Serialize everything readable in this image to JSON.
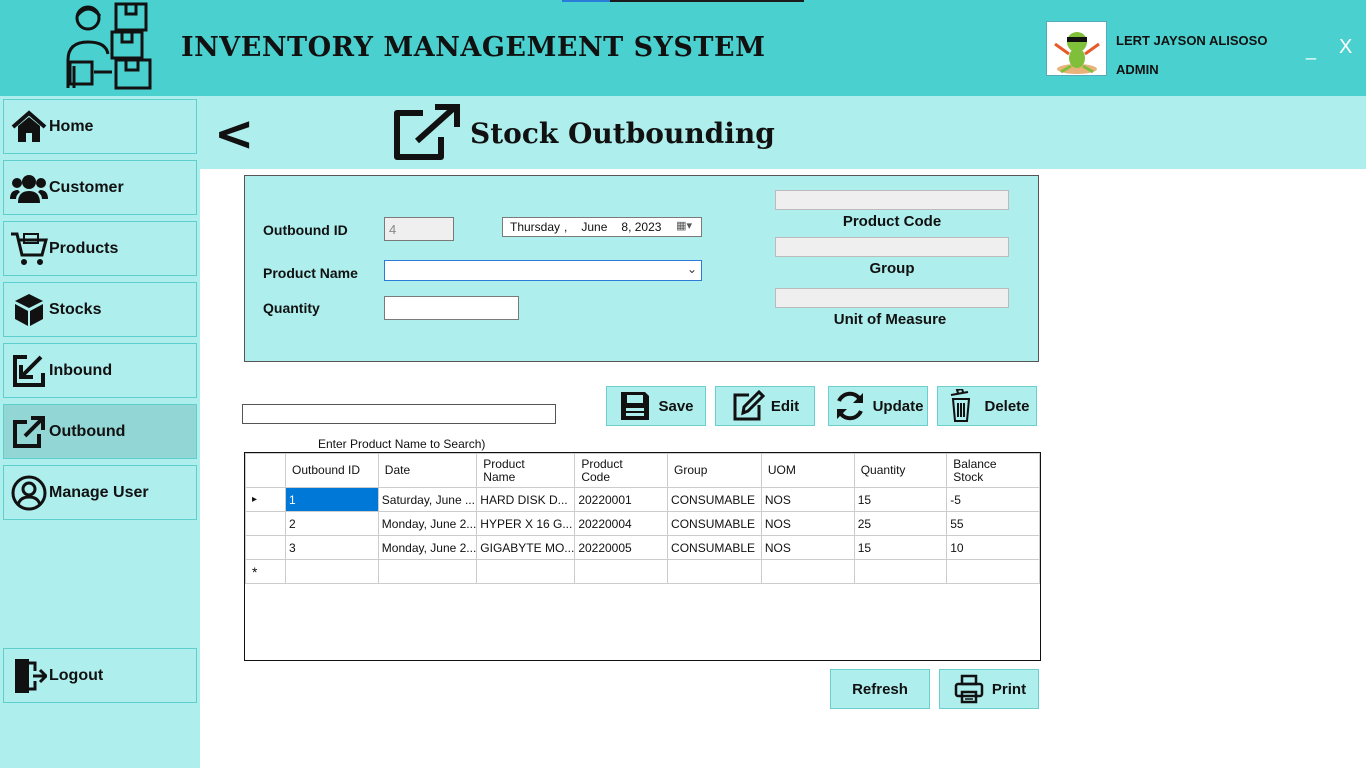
{
  "app": {
    "title": "INVENTORY MANAGEMENT SYSTEM",
    "user_name": "LERT JAYSON ALISOSO",
    "user_role": "ADMIN",
    "minimize_label": "_",
    "close_label": "X"
  },
  "sidebar": {
    "items": [
      {
        "label": "Home",
        "icon": "home-icon"
      },
      {
        "label": "Customer",
        "icon": "customers-icon"
      },
      {
        "label": "Products",
        "icon": "cart-icon"
      },
      {
        "label": "Stocks",
        "icon": "boxes-icon"
      },
      {
        "label": "Inbound",
        "icon": "inbound-icon"
      },
      {
        "label": "Outbound",
        "icon": "outbound-icon",
        "active": true
      },
      {
        "label": "Manage User",
        "icon": "user-icon"
      }
    ],
    "logout_label": "Logout"
  },
  "page": {
    "back_label": "<",
    "title": "Stock Outbounding"
  },
  "form": {
    "outbound_id_label": "Outbound ID",
    "outbound_id_value": "4",
    "date": {
      "day": "Thursday",
      "sep": ",",
      "month": "June",
      "date": "8, 2023"
    },
    "product_name_label": "Product Name",
    "product_name_value": "",
    "quantity_label": "Quantity",
    "quantity_value": "",
    "product_code_label": "Product Code",
    "group_label": "Group",
    "uom_label": "Unit of Measure"
  },
  "search": {
    "hint": "Enter Product Name to Search)",
    "value": ""
  },
  "buttons": {
    "save": "Save",
    "edit": "Edit",
    "update": "Update",
    "delete": "Delete",
    "refresh": "Refresh",
    "print": "Print"
  },
  "table": {
    "columns": [
      "Outbound ID",
      "Date",
      "Product Name",
      "Product Code",
      "Group",
      "UOM",
      "Quantity",
      "Balance Stock"
    ],
    "rows": [
      [
        "1",
        "Saturday, June ...",
        "HARD DISK D...",
        "20220001",
        "CONSUMABLE",
        "NOS",
        "15",
        "-5"
      ],
      [
        "2",
        "Monday, June 2...",
        "HYPER X 16 G...",
        "20220004",
        "CONSUMABLE",
        "NOS",
        "25",
        "55"
      ],
      [
        "3",
        "Monday, June 2...",
        "GIGABYTE MO...",
        "20220005",
        "CONSUMABLE",
        "NOS",
        "15",
        "10"
      ]
    ],
    "new_row_marker": "*",
    "current_row_marker": "▸"
  }
}
